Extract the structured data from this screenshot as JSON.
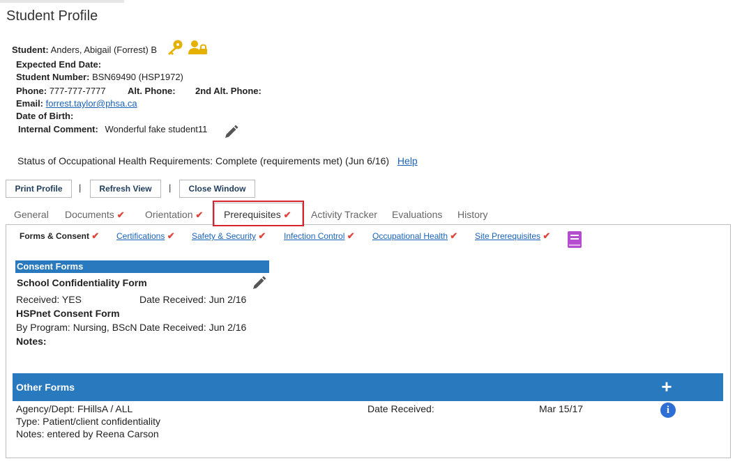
{
  "header": {
    "title": "Student Profile"
  },
  "student": {
    "student_label": "Student:",
    "student_name": "Anders, Abigail (Forrest) B",
    "expected_end_label": "Expected End Date:",
    "number_label": "Student Number:",
    "number_value": "BSN69490  (HSP1972)",
    "phone_label": "Phone:",
    "phone_value": "777-777-7777",
    "alt_phone_label": "Alt. Phone:",
    "alt2_phone_label": "2nd Alt. Phone:",
    "email_label": "Email:",
    "email_value": "forrest.taylor@phsa.ca",
    "dob_label": "Date of Birth:",
    "comment_label": "Internal Comment:",
    "comment_value": "Wonderful fake student11"
  },
  "status": {
    "text": "Status of Occupational Health Requirements: Complete (requirements met) (Jun 6/16)",
    "help": "Help"
  },
  "toolbar": {
    "print": "Print Profile",
    "refresh": "Refresh View",
    "close": "Close Window",
    "separator": "|"
  },
  "tabs": {
    "general": "General",
    "documents": "Documents",
    "orientation": "Orientation",
    "prerequisites": "Prerequisites",
    "activity": "Activity Tracker",
    "evaluations": "Evaluations",
    "history": "History",
    "check": "✔"
  },
  "subtabs": {
    "forms": "Forms & Consent",
    "certs": "Certifications",
    "safety": "Safety & Security",
    "infection": "Infection Control",
    "occ": "Occupational Health",
    "site": "Site Prerequisites"
  },
  "consent": {
    "header": "Consent Forms",
    "school_form": "School Confidentiality Form",
    "received": "Received: YES",
    "date1": "Date Received: Jun 2/16",
    "hspnet_form": "HSPnet Consent Form",
    "by_program": "By Program: Nursing, BScN",
    "date2": "Date Received: Jun 2/16",
    "notes": "Notes:"
  },
  "other": {
    "header": "Other Forms",
    "plus": "+",
    "agency": "Agency/Dept: FHillsA / ALL",
    "date_label": "Date Received:",
    "date_value": "Mar 15/17",
    "type": "Type: Patient/client confidentiality",
    "notes": "Notes: entered by Reena Carson",
    "info": "i"
  },
  "colors": {
    "accent": "#2979bf",
    "check": "#e0463c",
    "icon_gold": "#e6b000",
    "book": "#b34fcf",
    "highlight": "#d6232e"
  }
}
